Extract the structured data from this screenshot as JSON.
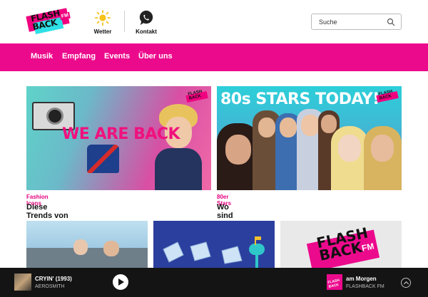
{
  "brand": {
    "logo_text": "FLASH BACK",
    "logo_fm": "FM",
    "pink": "#ec0a8c",
    "cyan": "#2ee0e6"
  },
  "header": {
    "weather_label": "Wetter",
    "contact_label": "Kontakt",
    "search_placeholder": "Suche",
    "weather_icon": "sun-icon",
    "contact_icon": "whatsapp-icon",
    "search_icon": "search-icon"
  },
  "nav": {
    "items": [
      "Musik",
      "Empfang",
      "Events",
      "Über uns"
    ]
  },
  "cards": [
    {
      "category": "Fashion Icons",
      "title": "Diese Trends von damals feiern ihr Comeback!",
      "image_text": "WE ARE BACK"
    },
    {
      "category": "80er Stars",
      "title": "Wo sind sie heute?",
      "image_text": "80s STARS TODAY!"
    }
  ],
  "tiles": [
    {
      "image": "convertible-photo"
    },
    {
      "image": "mail-illustration"
    },
    {
      "image": "flashback-logo",
      "logo_text": "FLASH BACK",
      "logo_fm": "FM"
    }
  ],
  "player": {
    "track_title": "CRYIN' (1993)",
    "artist": "AEROSMITH",
    "show_title": "am Morgen",
    "station": "FLASHBACK FM",
    "play_icon": "play-icon",
    "expand_icon": "chevron-up-icon"
  }
}
